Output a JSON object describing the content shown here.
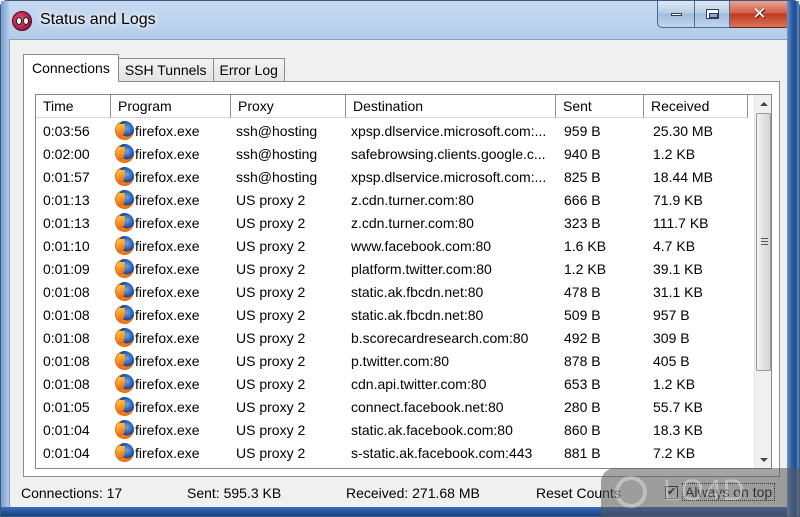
{
  "window": {
    "title": "Status and Logs",
    "app_icon": "proxifier-eyes-icon",
    "caption_buttons": [
      "minimize",
      "maximize",
      "close"
    ]
  },
  "tabs": [
    {
      "label": "Connections",
      "active": true
    },
    {
      "label": "SSH Tunnels",
      "active": false
    },
    {
      "label": "Error Log",
      "active": false
    }
  ],
  "table": {
    "columns": [
      "Time",
      "Program",
      "Proxy",
      "Destination",
      "Sent",
      "Received"
    ],
    "program_icon": "firefox-icon",
    "rows": [
      {
        "time": "0:03:56",
        "program": "firefox.exe",
        "proxy": "ssh@hosting",
        "destination": "xpsp.dlservice.microsoft.com:...",
        "sent": "959 B",
        "received": "25.30 MB"
      },
      {
        "time": "0:02:00",
        "program": "firefox.exe",
        "proxy": "ssh@hosting",
        "destination": "safebrowsing.clients.google.c...",
        "sent": "940 B",
        "received": "1.2 KB"
      },
      {
        "time": "0:01:57",
        "program": "firefox.exe",
        "proxy": "ssh@hosting",
        "destination": "xpsp.dlservice.microsoft.com:...",
        "sent": "825 B",
        "received": "18.44 MB"
      },
      {
        "time": "0:01:13",
        "program": "firefox.exe",
        "proxy": "US proxy 2",
        "destination": "z.cdn.turner.com:80",
        "sent": "666 B",
        "received": "71.9 KB"
      },
      {
        "time": "0:01:13",
        "program": "firefox.exe",
        "proxy": "US proxy 2",
        "destination": "z.cdn.turner.com:80",
        "sent": "323 B",
        "received": "111.7 KB"
      },
      {
        "time": "0:01:10",
        "program": "firefox.exe",
        "proxy": "US proxy 2",
        "destination": "www.facebook.com:80",
        "sent": "1.6 KB",
        "received": "4.7 KB"
      },
      {
        "time": "0:01:09",
        "program": "firefox.exe",
        "proxy": "US proxy 2",
        "destination": "platform.twitter.com:80",
        "sent": "1.2 KB",
        "received": "39.1 KB"
      },
      {
        "time": "0:01:08",
        "program": "firefox.exe",
        "proxy": "US proxy 2",
        "destination": "static.ak.fbcdn.net:80",
        "sent": "478 B",
        "received": "31.1 KB"
      },
      {
        "time": "0:01:08",
        "program": "firefox.exe",
        "proxy": "US proxy 2",
        "destination": "static.ak.fbcdn.net:80",
        "sent": "509 B",
        "received": "957 B"
      },
      {
        "time": "0:01:08",
        "program": "firefox.exe",
        "proxy": "US proxy 2",
        "destination": "b.scorecardresearch.com:80",
        "sent": "492 B",
        "received": "309 B"
      },
      {
        "time": "0:01:08",
        "program": "firefox.exe",
        "proxy": "US proxy 2",
        "destination": "p.twitter.com:80",
        "sent": "878 B",
        "received": "405 B"
      },
      {
        "time": "0:01:08",
        "program": "firefox.exe",
        "proxy": "US proxy 2",
        "destination": "cdn.api.twitter.com:80",
        "sent": "653 B",
        "received": "1.2 KB"
      },
      {
        "time": "0:01:05",
        "program": "firefox.exe",
        "proxy": "US proxy 2",
        "destination": "connect.facebook.net:80",
        "sent": "280 B",
        "received": "55.7 KB"
      },
      {
        "time": "0:01:04",
        "program": "firefox.exe",
        "proxy": "US proxy 2",
        "destination": "static.ak.facebook.com:80",
        "sent": "860 B",
        "received": "18.3 KB"
      },
      {
        "time": "0:01:04",
        "program": "firefox.exe",
        "proxy": "US proxy 2",
        "destination": "s-static.ak.facebook.com:443",
        "sent": "881 B",
        "received": "7.2 KB"
      }
    ]
  },
  "status": {
    "connections": "Connections: 17",
    "sent": "Sent:  595.3 KB",
    "received": "Received:  271.68 MB",
    "reset_label": "Reset Counts",
    "always_on_top_label": "Always on top",
    "always_on_top_checked": true,
    "check_mark": "✔"
  },
  "watermark": {
    "text": "LO4D"
  }
}
